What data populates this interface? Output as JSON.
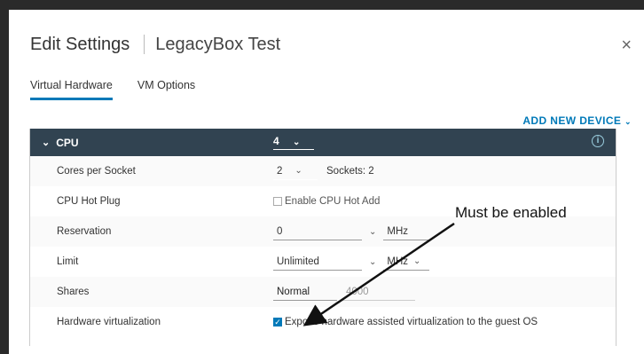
{
  "dialog": {
    "title": "Edit Settings",
    "subtitle": "LegacyBox Test",
    "close_glyph": "×"
  },
  "tabs": [
    {
      "label": "Virtual Hardware",
      "active": true
    },
    {
      "label": "VM Options",
      "active": false
    }
  ],
  "add_device_label": "ADD NEW DEVICE",
  "cpu": {
    "label": "CPU",
    "count": "4",
    "info_glyph": "i"
  },
  "rows": {
    "cores": {
      "label": "Cores per Socket",
      "value": "2",
      "sockets": "Sockets: 2"
    },
    "hotplug": {
      "label": "CPU Hot Plug",
      "option": "Enable CPU Hot Add",
      "checked": false
    },
    "reservation": {
      "label": "Reservation",
      "value": "0",
      "unit": "MHz"
    },
    "limit": {
      "label": "Limit",
      "value": "Unlimited",
      "unit": "MHz"
    },
    "shares": {
      "label": "Shares",
      "value": "Normal",
      "amount": "4000"
    },
    "hwvirt": {
      "label": "Hardware virtualization",
      "option": "Expose hardware assisted virtualization to the guest OS",
      "checked": true
    }
  },
  "annotation": {
    "text": "Must be enabled"
  },
  "colors": {
    "accent": "#0079b8",
    "header_bg": "#314351"
  }
}
